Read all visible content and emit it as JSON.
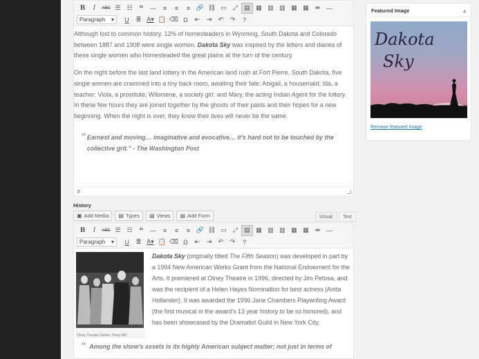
{
  "toolbar": {
    "format_value": "Paragraph"
  },
  "editor1": {
    "paragraphs": [
      "Although lost to common history, 12% of homesteaders in Wyoming, South Dakota and Colorado between 1887 and 1908 were single women. ",
      "On the night before the last land lottery in the American land rush at Fort Pierre, South Dakota, five single women are crammed into a tiny back room, awaiting their fate: Abigail, a housemaid; Ida, a teacher; Viola, a prostitute; Wilomene, a society girl; and Mary, the acting Indian Agent for the lottery. In these few hours they are joined together by the ghosts of their pasts and their hopes for a new beginning. When the night is over, they know their lives will never be the same."
    ],
    "p1_strong": "Dakota Sky",
    "p1_tail": " was inspired by the letters and diaries of these single women who homesteaded the great plains at the turn of the century.",
    "quote": "Earnest and moving… imaginative and evocative… it's hard not to be touched by the collective grit.\" - The Washington Post",
    "status_path": "p"
  },
  "history": {
    "label": "History",
    "buttons": [
      "Add Media",
      "Types",
      "Views",
      "Add Form"
    ],
    "tabs": [
      "Visual",
      "Text"
    ]
  },
  "editor2": {
    "strong": "Dakota Sky",
    "text1": " (originally titled ",
    "italic": "The Fifth Season",
    "text2": ") was developed in part by a 1994 New American Works Grant from the National Endowment for the Arts. It premiered at Olney Theatre in 1996, directed by Jim Petosa, and was the recipient of a Helen Hayes Nomination for best actress (Anita Hollander). It was awarded the 1996 Jane Chambers Playwriting Award (the first musical in the award's 13 year history to be so honored), and has been showcased by the Dramatist Guild in New York City.",
    "caption": "Olney Theatre Center, Olney MD",
    "quote": "Among the show's assets is its highly American subject matter; not just in terms of"
  },
  "featured": {
    "header": "Featured Image",
    "image_text_1": "Dakota",
    "image_text_2": "Sky",
    "remove_link": "Remove featured image"
  }
}
